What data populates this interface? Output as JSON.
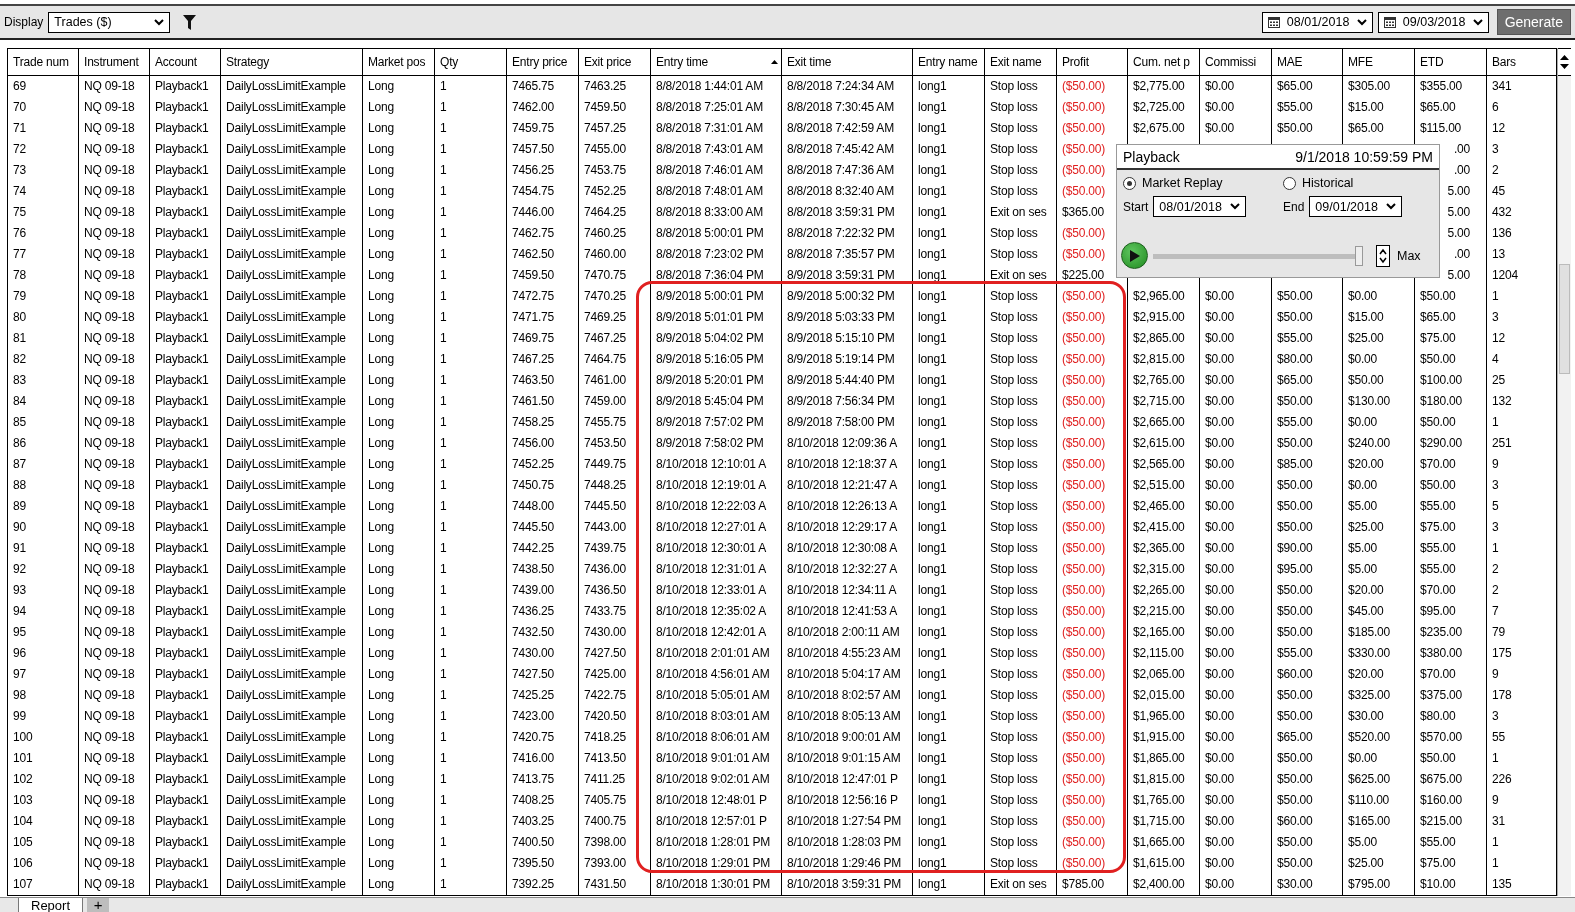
{
  "toolbar": {
    "display_label": "Display",
    "display_value": "Trades ($)",
    "start_date": "08/01/2018",
    "end_date": "09/03/2018",
    "generate_button": "Generate"
  },
  "table": {
    "columns": [
      {
        "label": "Trade num",
        "sorted": false
      },
      {
        "label": "Instrument",
        "sorted": false
      },
      {
        "label": "Account",
        "sorted": false
      },
      {
        "label": "Strategy",
        "sorted": false
      },
      {
        "label": "Market pos",
        "sorted": false
      },
      {
        "label": "Qty",
        "sorted": false
      },
      {
        "label": "Entry price",
        "sorted": false
      },
      {
        "label": "Exit price",
        "sorted": false
      },
      {
        "label": "Entry time",
        "sorted": true
      },
      {
        "label": "Exit time",
        "sorted": false
      },
      {
        "label": "Entry name",
        "sorted": false
      },
      {
        "label": "Exit name",
        "sorted": false
      },
      {
        "label": "Profit",
        "sorted": false
      },
      {
        "label": "Cum. net p",
        "sorted": false
      },
      {
        "label": "Commissi",
        "sorted": false
      },
      {
        "label": "MAE",
        "sorted": false
      },
      {
        "label": "MFE",
        "sorted": false
      },
      {
        "label": "ETD",
        "sorted": false
      },
      {
        "label": "Bars",
        "sorted": false
      }
    ],
    "rows": [
      {
        "loss": true,
        "cells": [
          "69",
          "NQ 09-18",
          "Playback1",
          "DailyLossLimitExample",
          "Long",
          "1",
          "7465.75",
          "7463.25",
          "8/8/2018 1:44:01 AM",
          "8/8/2018 7:24:34 AM",
          "long1",
          "Stop loss",
          "($50.00)",
          "$2,775.00",
          "$0.00",
          "$65.00",
          "$305.00",
          "$355.00",
          "341"
        ]
      },
      {
        "loss": true,
        "cells": [
          "70",
          "NQ 09-18",
          "Playback1",
          "DailyLossLimitExample",
          "Long",
          "1",
          "7462.00",
          "7459.50",
          "8/8/2018 7:25:01 AM",
          "8/8/2018 7:30:45 AM",
          "long1",
          "Stop loss",
          "($50.00)",
          "$2,725.00",
          "$0.00",
          "$55.00",
          "$15.00",
          "$65.00",
          "6"
        ]
      },
      {
        "loss": true,
        "cells": [
          "71",
          "NQ 09-18",
          "Playback1",
          "DailyLossLimitExample",
          "Long",
          "1",
          "7459.75",
          "7457.25",
          "8/8/2018 7:31:01 AM",
          "8/8/2018 7:42:59 AM",
          "long1",
          "Stop loss",
          "($50.00)",
          "$2,675.00",
          "$0.00",
          "$50.00",
          "$65.00",
          "$115.00",
          "12"
        ]
      },
      {
        "loss": true,
        "cells": [
          "72",
          "NQ 09-18",
          "Playback1",
          "DailyLossLimitExample",
          "Long",
          "1",
          "7457.50",
          "7455.00",
          "8/8/2018 7:43:01 AM",
          "8/8/2018 7:45:42 AM",
          "long1",
          "Stop loss",
          "($50.00)",
          null,
          null,
          null,
          null,
          ".00",
          "3"
        ]
      },
      {
        "loss": true,
        "cells": [
          "73",
          "NQ 09-18",
          "Playback1",
          "DailyLossLimitExample",
          "Long",
          "1",
          "7456.25",
          "7453.75",
          "8/8/2018 7:46:01 AM",
          "8/8/2018 7:47:36 AM",
          "long1",
          "Stop loss",
          "($50.00)",
          null,
          null,
          null,
          null,
          ".00",
          "2"
        ]
      },
      {
        "loss": true,
        "cells": [
          "74",
          "NQ 09-18",
          "Playback1",
          "DailyLossLimitExample",
          "Long",
          "1",
          "7454.75",
          "7452.25",
          "8/8/2018 7:48:01 AM",
          "8/8/2018 8:32:40 AM",
          "long1",
          "Stop loss",
          "($50.00)",
          null,
          null,
          null,
          null,
          "5.00",
          "45"
        ]
      },
      {
        "loss": false,
        "cells": [
          "75",
          "NQ 09-18",
          "Playback1",
          "DailyLossLimitExample",
          "Long",
          "1",
          "7446.00",
          "7464.25",
          "8/8/2018 8:33:00 AM",
          "8/8/2018 3:59:31 PM",
          "long1",
          "Exit on ses",
          "$365.00",
          null,
          null,
          null,
          null,
          "5.00",
          "432"
        ]
      },
      {
        "loss": true,
        "cells": [
          "76",
          "NQ 09-18",
          "Playback1",
          "DailyLossLimitExample",
          "Long",
          "1",
          "7462.75",
          "7460.25",
          "8/8/2018 5:00:01 PM",
          "8/8/2018 7:22:32 PM",
          "long1",
          "Stop loss",
          "($50.00)",
          null,
          null,
          null,
          null,
          "5.00",
          "136"
        ]
      },
      {
        "loss": true,
        "cells": [
          "77",
          "NQ 09-18",
          "Playback1",
          "DailyLossLimitExample",
          "Long",
          "1",
          "7462.50",
          "7460.00",
          "8/8/2018 7:23:02 PM",
          "8/8/2018 7:35:57 PM",
          "long1",
          "Stop loss",
          "($50.00)",
          null,
          null,
          null,
          null,
          ".00",
          "13"
        ]
      },
      {
        "loss": false,
        "cells": [
          "78",
          "NQ 09-18",
          "Playback1",
          "DailyLossLimitExample",
          "Long",
          "1",
          "7459.50",
          "7470.75",
          "8/8/2018 7:36:04 PM",
          "8/9/2018 3:59:31 PM",
          "long1",
          "Exit on ses",
          "$225.00",
          null,
          null,
          null,
          null,
          "5.00",
          "1204"
        ]
      },
      {
        "loss": true,
        "cells": [
          "79",
          "NQ 09-18",
          "Playback1",
          "DailyLossLimitExample",
          "Long",
          "1",
          "7472.75",
          "7470.25",
          "8/9/2018 5:00:01 PM",
          "8/9/2018 5:00:32 PM",
          "long1",
          "Stop loss",
          "($50.00)",
          "$2,965.00",
          "$0.00",
          "$50.00",
          "$0.00",
          "$50.00",
          "1"
        ]
      },
      {
        "loss": true,
        "cells": [
          "80",
          "NQ 09-18",
          "Playback1",
          "DailyLossLimitExample",
          "Long",
          "1",
          "7471.75",
          "7469.25",
          "8/9/2018 5:01:01 PM",
          "8/9/2018 5:03:33 PM",
          "long1",
          "Stop loss",
          "($50.00)",
          "$2,915.00",
          "$0.00",
          "$50.00",
          "$15.00",
          "$65.00",
          "3"
        ]
      },
      {
        "loss": true,
        "cells": [
          "81",
          "NQ 09-18",
          "Playback1",
          "DailyLossLimitExample",
          "Long",
          "1",
          "7469.75",
          "7467.25",
          "8/9/2018 5:04:02 PM",
          "8/9/2018 5:15:10 PM",
          "long1",
          "Stop loss",
          "($50.00)",
          "$2,865.00",
          "$0.00",
          "$55.00",
          "$25.00",
          "$75.00",
          "12"
        ]
      },
      {
        "loss": true,
        "cells": [
          "82",
          "NQ 09-18",
          "Playback1",
          "DailyLossLimitExample",
          "Long",
          "1",
          "7467.25",
          "7464.75",
          "8/9/2018 5:16:05 PM",
          "8/9/2018 5:19:14 PM",
          "long1",
          "Stop loss",
          "($50.00)",
          "$2,815.00",
          "$0.00",
          "$80.00",
          "$0.00",
          "$50.00",
          "4"
        ]
      },
      {
        "loss": true,
        "cells": [
          "83",
          "NQ 09-18",
          "Playback1",
          "DailyLossLimitExample",
          "Long",
          "1",
          "7463.50",
          "7461.00",
          "8/9/2018 5:20:01 PM",
          "8/9/2018 5:44:40 PM",
          "long1",
          "Stop loss",
          "($50.00)",
          "$2,765.00",
          "$0.00",
          "$65.00",
          "$50.00",
          "$100.00",
          "25"
        ]
      },
      {
        "loss": true,
        "cells": [
          "84",
          "NQ 09-18",
          "Playback1",
          "DailyLossLimitExample",
          "Long",
          "1",
          "7461.50",
          "7459.00",
          "8/9/2018 5:45:04 PM",
          "8/9/2018 7:56:34 PM",
          "long1",
          "Stop loss",
          "($50.00)",
          "$2,715.00",
          "$0.00",
          "$50.00",
          "$130.00",
          "$180.00",
          "132"
        ]
      },
      {
        "loss": true,
        "cells": [
          "85",
          "NQ 09-18",
          "Playback1",
          "DailyLossLimitExample",
          "Long",
          "1",
          "7458.25",
          "7455.75",
          "8/9/2018 7:57:02 PM",
          "8/9/2018 7:58:00 PM",
          "long1",
          "Stop loss",
          "($50.00)",
          "$2,665.00",
          "$0.00",
          "$55.00",
          "$0.00",
          "$50.00",
          "1"
        ]
      },
      {
        "loss": true,
        "cells": [
          "86",
          "NQ 09-18",
          "Playback1",
          "DailyLossLimitExample",
          "Long",
          "1",
          "7456.00",
          "7453.50",
          "8/9/2018 7:58:02 PM",
          "8/10/2018 12:09:36 A",
          "long1",
          "Stop loss",
          "($50.00)",
          "$2,615.00",
          "$0.00",
          "$50.00",
          "$240.00",
          "$290.00",
          "251"
        ]
      },
      {
        "loss": true,
        "cells": [
          "87",
          "NQ 09-18",
          "Playback1",
          "DailyLossLimitExample",
          "Long",
          "1",
          "7452.25",
          "7449.75",
          "8/10/2018 12:10:01 A",
          "8/10/2018 12:18:37 A",
          "long1",
          "Stop loss",
          "($50.00)",
          "$2,565.00",
          "$0.00",
          "$85.00",
          "$20.00",
          "$70.00",
          "9"
        ]
      },
      {
        "loss": true,
        "cells": [
          "88",
          "NQ 09-18",
          "Playback1",
          "DailyLossLimitExample",
          "Long",
          "1",
          "7450.75",
          "7448.25",
          "8/10/2018 12:19:01 A",
          "8/10/2018 12:21:47 A",
          "long1",
          "Stop loss",
          "($50.00)",
          "$2,515.00",
          "$0.00",
          "$50.00",
          "$0.00",
          "$50.00",
          "3"
        ]
      },
      {
        "loss": true,
        "cells": [
          "89",
          "NQ 09-18",
          "Playback1",
          "DailyLossLimitExample",
          "Long",
          "1",
          "7448.00",
          "7445.50",
          "8/10/2018 12:22:03 A",
          "8/10/2018 12:26:13 A",
          "long1",
          "Stop loss",
          "($50.00)",
          "$2,465.00",
          "$0.00",
          "$50.00",
          "$5.00",
          "$55.00",
          "5"
        ]
      },
      {
        "loss": true,
        "cells": [
          "90",
          "NQ 09-18",
          "Playback1",
          "DailyLossLimitExample",
          "Long",
          "1",
          "7445.50",
          "7443.00",
          "8/10/2018 12:27:01 A",
          "8/10/2018 12:29:17 A",
          "long1",
          "Stop loss",
          "($50.00)",
          "$2,415.00",
          "$0.00",
          "$50.00",
          "$25.00",
          "$75.00",
          "3"
        ]
      },
      {
        "loss": true,
        "cells": [
          "91",
          "NQ 09-18",
          "Playback1",
          "DailyLossLimitExample",
          "Long",
          "1",
          "7442.25",
          "7439.75",
          "8/10/2018 12:30:01 A",
          "8/10/2018 12:30:08 A",
          "long1",
          "Stop loss",
          "($50.00)",
          "$2,365.00",
          "$0.00",
          "$90.00",
          "$5.00",
          "$55.00",
          "1"
        ]
      },
      {
        "loss": true,
        "cells": [
          "92",
          "NQ 09-18",
          "Playback1",
          "DailyLossLimitExample",
          "Long",
          "1",
          "7438.50",
          "7436.00",
          "8/10/2018 12:31:01 A",
          "8/10/2018 12:32:27 A",
          "long1",
          "Stop loss",
          "($50.00)",
          "$2,315.00",
          "$0.00",
          "$95.00",
          "$5.00",
          "$55.00",
          "2"
        ]
      },
      {
        "loss": true,
        "cells": [
          "93",
          "NQ 09-18",
          "Playback1",
          "DailyLossLimitExample",
          "Long",
          "1",
          "7439.00",
          "7436.50",
          "8/10/2018 12:33:01 A",
          "8/10/2018 12:34:11 A",
          "long1",
          "Stop loss",
          "($50.00)",
          "$2,265.00",
          "$0.00",
          "$50.00",
          "$20.00",
          "$70.00",
          "2"
        ]
      },
      {
        "loss": true,
        "cells": [
          "94",
          "NQ 09-18",
          "Playback1",
          "DailyLossLimitExample",
          "Long",
          "1",
          "7436.25",
          "7433.75",
          "8/10/2018 12:35:02 A",
          "8/10/2018 12:41:53 A",
          "long1",
          "Stop loss",
          "($50.00)",
          "$2,215.00",
          "$0.00",
          "$50.00",
          "$45.00",
          "$95.00",
          "7"
        ]
      },
      {
        "loss": true,
        "cells": [
          "95",
          "NQ 09-18",
          "Playback1",
          "DailyLossLimitExample",
          "Long",
          "1",
          "7432.50",
          "7430.00",
          "8/10/2018 12:42:01 A",
          "8/10/2018 2:00:11 AM",
          "long1",
          "Stop loss",
          "($50.00)",
          "$2,165.00",
          "$0.00",
          "$50.00",
          "$185.00",
          "$235.00",
          "79"
        ]
      },
      {
        "loss": true,
        "cells": [
          "96",
          "NQ 09-18",
          "Playback1",
          "DailyLossLimitExample",
          "Long",
          "1",
          "7430.00",
          "7427.50",
          "8/10/2018 2:01:01 AM",
          "8/10/2018 4:55:23 AM",
          "long1",
          "Stop loss",
          "($50.00)",
          "$2,115.00",
          "$0.00",
          "$55.00",
          "$330.00",
          "$380.00",
          "175"
        ]
      },
      {
        "loss": true,
        "cells": [
          "97",
          "NQ 09-18",
          "Playback1",
          "DailyLossLimitExample",
          "Long",
          "1",
          "7427.50",
          "7425.00",
          "8/10/2018 4:56:01 AM",
          "8/10/2018 5:04:17 AM",
          "long1",
          "Stop loss",
          "($50.00)",
          "$2,065.00",
          "$0.00",
          "$60.00",
          "$20.00",
          "$70.00",
          "9"
        ]
      },
      {
        "loss": true,
        "cells": [
          "98",
          "NQ 09-18",
          "Playback1",
          "DailyLossLimitExample",
          "Long",
          "1",
          "7425.25",
          "7422.75",
          "8/10/2018 5:05:01 AM",
          "8/10/2018 8:02:57 AM",
          "long1",
          "Stop loss",
          "($50.00)",
          "$2,015.00",
          "$0.00",
          "$50.00",
          "$325.00",
          "$375.00",
          "178"
        ]
      },
      {
        "loss": true,
        "cells": [
          "99",
          "NQ 09-18",
          "Playback1",
          "DailyLossLimitExample",
          "Long",
          "1",
          "7423.00",
          "7420.50",
          "8/10/2018 8:03:01 AM",
          "8/10/2018 8:05:13 AM",
          "long1",
          "Stop loss",
          "($50.00)",
          "$1,965.00",
          "$0.00",
          "$50.00",
          "$30.00",
          "$80.00",
          "3"
        ]
      },
      {
        "loss": true,
        "cells": [
          "100",
          "NQ 09-18",
          "Playback1",
          "DailyLossLimitExample",
          "Long",
          "1",
          "7420.75",
          "7418.25",
          "8/10/2018 8:06:01 AM",
          "8/10/2018 9:00:01 AM",
          "long1",
          "Stop loss",
          "($50.00)",
          "$1,915.00",
          "$0.00",
          "$65.00",
          "$520.00",
          "$570.00",
          "55"
        ]
      },
      {
        "loss": true,
        "cells": [
          "101",
          "NQ 09-18",
          "Playback1",
          "DailyLossLimitExample",
          "Long",
          "1",
          "7416.00",
          "7413.50",
          "8/10/2018 9:01:01 AM",
          "8/10/2018 9:01:15 AM",
          "long1",
          "Stop loss",
          "($50.00)",
          "$1,865.00",
          "$0.00",
          "$50.00",
          "$0.00",
          "$50.00",
          "1"
        ]
      },
      {
        "loss": true,
        "cells": [
          "102",
          "NQ 09-18",
          "Playback1",
          "DailyLossLimitExample",
          "Long",
          "1",
          "7413.75",
          "7411.25",
          "8/10/2018 9:02:01 AM",
          "8/10/2018 12:47:01 P",
          "long1",
          "Stop loss",
          "($50.00)",
          "$1,815.00",
          "$0.00",
          "$50.00",
          "$625.00",
          "$675.00",
          "226"
        ]
      },
      {
        "loss": true,
        "cells": [
          "103",
          "NQ 09-18",
          "Playback1",
          "DailyLossLimitExample",
          "Long",
          "1",
          "7408.25",
          "7405.75",
          "8/10/2018 12:48:01 P",
          "8/10/2018 12:56:16 P",
          "long1",
          "Stop loss",
          "($50.00)",
          "$1,765.00",
          "$0.00",
          "$50.00",
          "$110.00",
          "$160.00",
          "9"
        ]
      },
      {
        "loss": true,
        "cells": [
          "104",
          "NQ 09-18",
          "Playback1",
          "DailyLossLimitExample",
          "Long",
          "1",
          "7403.25",
          "7400.75",
          "8/10/2018 12:57:01 P",
          "8/10/2018 1:27:54 PM",
          "long1",
          "Stop loss",
          "($50.00)",
          "$1,715.00",
          "$0.00",
          "$60.00",
          "$165.00",
          "$215.00",
          "31"
        ]
      },
      {
        "loss": true,
        "cells": [
          "105",
          "NQ 09-18",
          "Playback1",
          "DailyLossLimitExample",
          "Long",
          "1",
          "7400.50",
          "7398.00",
          "8/10/2018 1:28:01 PM",
          "8/10/2018 1:28:03 PM",
          "long1",
          "Stop loss",
          "($50.00)",
          "$1,665.00",
          "$0.00",
          "$50.00",
          "$5.00",
          "$55.00",
          "1"
        ]
      },
      {
        "loss": true,
        "cells": [
          "106",
          "NQ 09-18",
          "Playback1",
          "DailyLossLimitExample",
          "Long",
          "1",
          "7395.50",
          "7393.00",
          "8/10/2018 1:29:01 PM",
          "8/10/2018 1:29:46 PM",
          "long1",
          "Stop loss",
          "($50.00)",
          "$1,615.00",
          "$0.00",
          "$50.00",
          "$25.00",
          "$75.00",
          "1"
        ]
      },
      {
        "loss": false,
        "cells": [
          "107",
          "NQ 09-18",
          "Playback1",
          "DailyLossLimitExample",
          "Long",
          "1",
          "7392.25",
          "7431.50",
          "8/10/2018 1:30:01 PM",
          "8/10/2018 3:59:31 PM",
          "long1",
          "Exit on ses",
          "$785.00",
          "$2,400.00",
          "$0.00",
          "$30.00",
          "$795.00",
          "$10.00",
          "135"
        ]
      }
    ]
  },
  "playback": {
    "title": "Playback",
    "time": "9/1/2018 10:59:59 PM",
    "modes": [
      {
        "label": "Market Replay",
        "selected": true
      },
      {
        "label": "Historical",
        "selected": false
      }
    ],
    "start_label": "Start",
    "start_date": "08/01/2018",
    "end_label": "End",
    "end_date": "09/01/2018",
    "slider": {
      "level": 1.0
    },
    "max_label": "Max"
  },
  "bottom_tabs": [
    {
      "label": "Report",
      "selected": true
    }
  ],
  "add_tab_button": "+"
}
